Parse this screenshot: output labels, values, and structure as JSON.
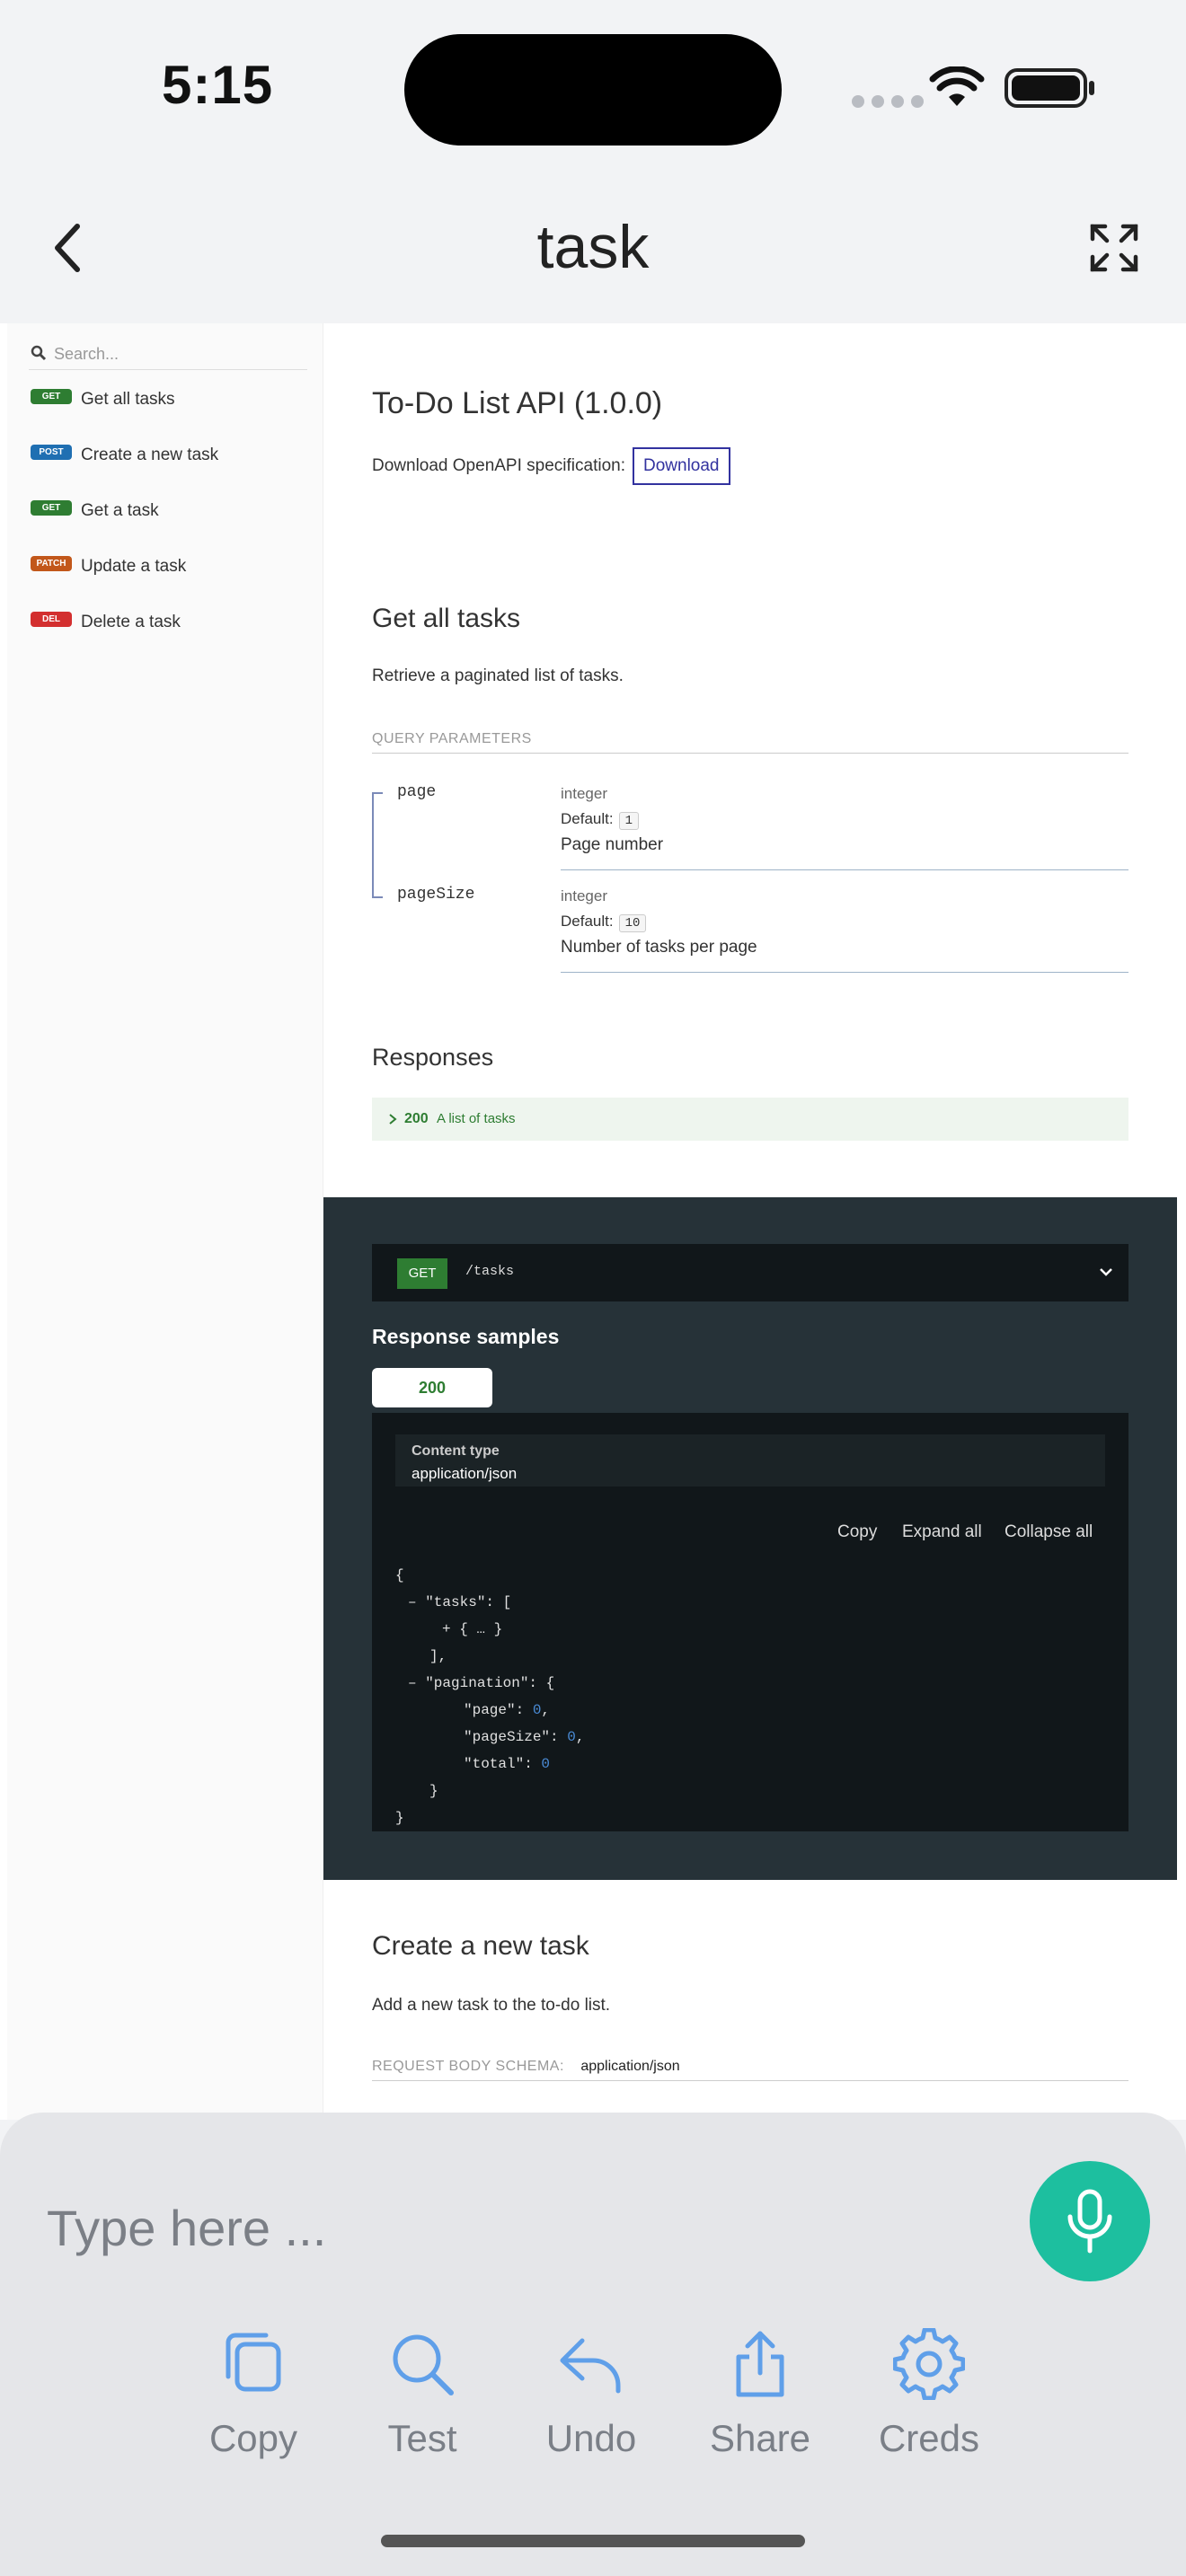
{
  "status_bar": {
    "time": "5:15"
  },
  "header": {
    "title": "task"
  },
  "sidebar": {
    "search_placeholder": "Search...",
    "items": [
      {
        "method": "GET",
        "label": "Get all tasks",
        "color": "#2e7d32"
      },
      {
        "method": "POST",
        "label": "Create a new task",
        "color": "#1f6fb2"
      },
      {
        "method": "GET",
        "label": "Get a task",
        "color": "#2e7d32"
      },
      {
        "method": "PATCH",
        "label": "Update a task",
        "color": "#c2571a"
      },
      {
        "method": "DEL",
        "label": "Delete a task",
        "color": "#d32f2f"
      }
    ]
  },
  "api": {
    "title": "To-Do List API (1.0.0)",
    "download_label": "Download OpenAPI specification:",
    "download_button": "Download"
  },
  "get_all": {
    "title": "Get all tasks",
    "description": "Retrieve a paginated list of tasks.",
    "query_label": "QUERY PARAMETERS",
    "params": [
      {
        "name": "page",
        "type": "integer",
        "default_label": "Default:",
        "default": "1",
        "description": "Page number"
      },
      {
        "name": "pageSize",
        "type": "integer",
        "default_label": "Default:",
        "default": "10",
        "description": "Number of tasks per page"
      }
    ],
    "responses_title": "Responses",
    "response_code": "200",
    "response_text": "A list of tasks"
  },
  "sample": {
    "method": "GET",
    "path": "/tasks",
    "title": "Response samples",
    "tab": "200",
    "content_type_label": "Content type",
    "content_type": "application/json",
    "copy": "Copy",
    "expand_all": "Expand all",
    "collapse_all": "Collapse all",
    "code": {
      "l1": "{",
      "l2": "– \"tasks\": [",
      "l3": "+ { … }",
      "l4": "],",
      "l5": "– \"pagination\": {",
      "l6a": "\"page\": ",
      "l6b": "0",
      "l6c": ",",
      "l7a": "\"pageSize\": ",
      "l7b": "0",
      "l7c": ",",
      "l8a": "\"total\": ",
      "l8b": "0",
      "l9": "}",
      "l10": "}"
    }
  },
  "create": {
    "title": "Create a new task",
    "description": "Add a new task to the to-do list.",
    "body_label": "REQUEST BODY SCHEMA:",
    "body_type": "application/json"
  },
  "composer": {
    "placeholder": "Type here ...",
    "tools": [
      "Copy",
      "Test",
      "Undo",
      "Share",
      "Creds"
    ]
  }
}
